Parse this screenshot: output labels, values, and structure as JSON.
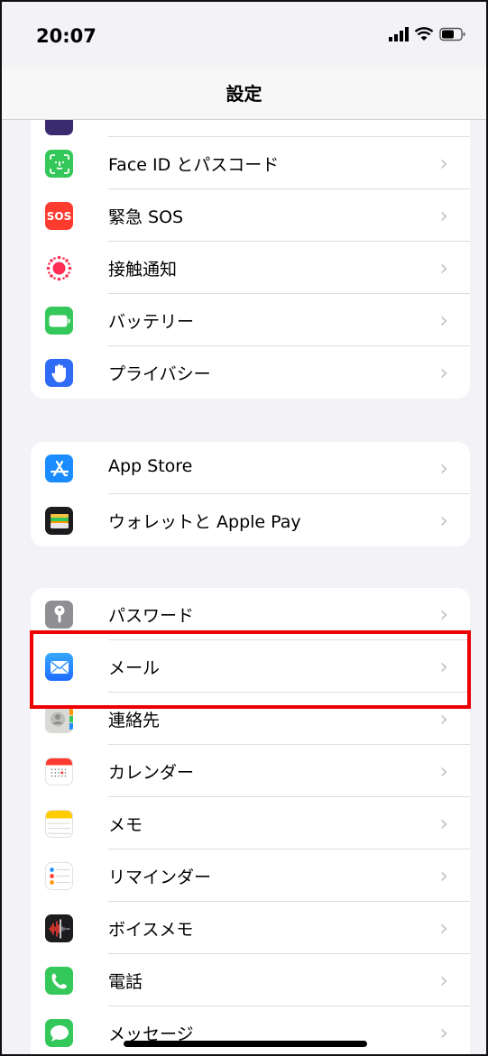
{
  "status": {
    "time": "20:07"
  },
  "nav": {
    "title": "設定"
  },
  "group1": [
    {
      "label": "Face ID とパスコード",
      "icon": "face-id-icon",
      "color": "#34c759"
    },
    {
      "label": "緊急 SOS",
      "icon": "sos-icon",
      "color": "#ff3b30",
      "icon_text": "SOS"
    },
    {
      "label": "接触通知",
      "icon": "exposure-notification-icon",
      "color": "#ff2d55"
    },
    {
      "label": "バッテリー",
      "icon": "battery-icon",
      "color": "#34c759"
    },
    {
      "label": "プライバシー",
      "icon": "hand-icon",
      "color": "#2f6bf5"
    }
  ],
  "group2": [
    {
      "label": "App Store",
      "icon": "app-store-icon",
      "color": "#1a8cff"
    },
    {
      "label": "ウォレットと Apple Pay",
      "icon": "wallet-icon",
      "color": "#000000"
    }
  ],
  "group3": [
    {
      "label": "パスワード",
      "icon": "key-icon",
      "color": "#8e8e93"
    },
    {
      "label": "メール",
      "icon": "mail-icon",
      "color": "#1e8bff"
    },
    {
      "label": "連絡先",
      "icon": "contacts-icon",
      "color": "#d9d9d9"
    },
    {
      "label": "カレンダー",
      "icon": "calendar-icon",
      "color": "#ffffff"
    },
    {
      "label": "メモ",
      "icon": "notes-icon",
      "color": "#ffffff"
    },
    {
      "label": "リマインダー",
      "icon": "reminders-icon",
      "color": "#ffffff"
    },
    {
      "label": "ボイスメモ",
      "icon": "voice-memos-icon",
      "color": "#1c1c1e"
    },
    {
      "label": "電話",
      "icon": "phone-icon",
      "color": "#34c759"
    },
    {
      "label": "メッセージ",
      "icon": "messages-icon",
      "color": "#34c759"
    }
  ]
}
